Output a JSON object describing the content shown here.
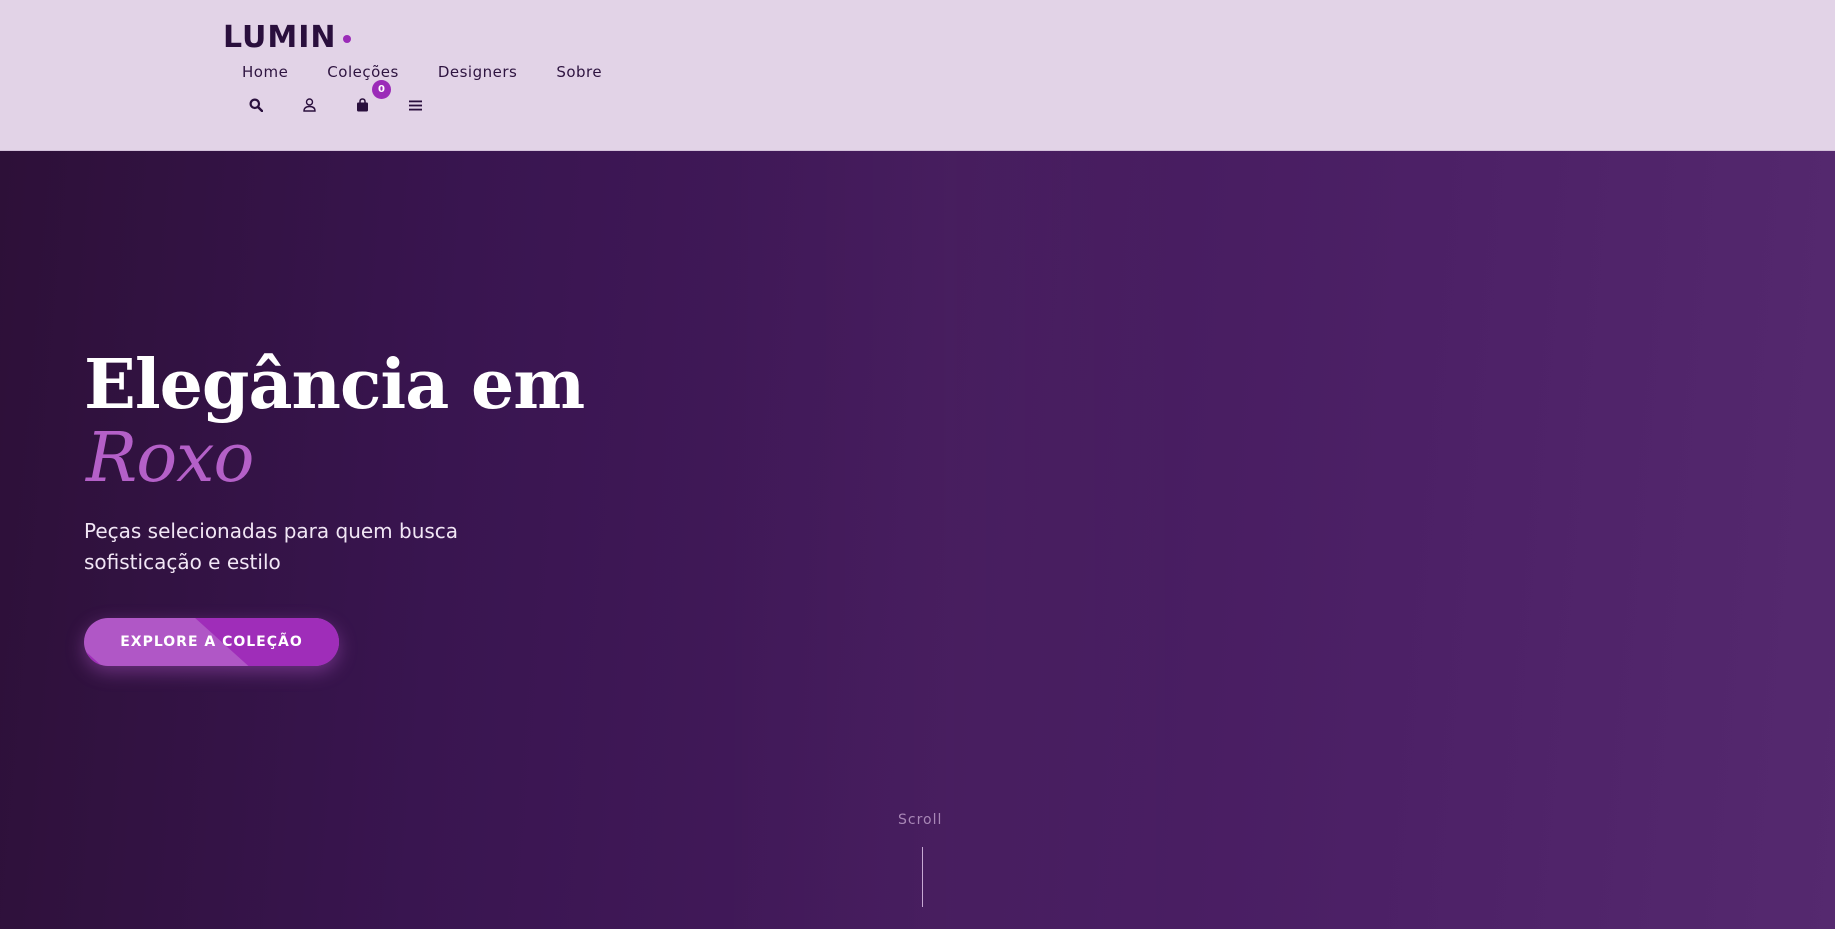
{
  "brand": {
    "name": "LUMIN",
    "accent_color": "#9b2bb8"
  },
  "nav": {
    "links": [
      {
        "label": "Home"
      },
      {
        "label": "Coleções"
      },
      {
        "label": "Designers"
      },
      {
        "label": "Sobre"
      }
    ]
  },
  "header_icons": {
    "search": "search-icon",
    "account": "user-icon",
    "cart": "shopping-bag-icon",
    "menu": "hamburger-menu-icon",
    "cart_count": "0"
  },
  "hero": {
    "title": "Elegância em",
    "title_accent": "Roxo",
    "subtitle": "Peças selecionadas para quem busca sofisticação e estilo",
    "cta_label": "EXPLORE A COLEÇÃO",
    "scroll_label": "Scroll"
  },
  "colors": {
    "header_bg": "#e2d3e7",
    "hero_bg_start": "#2d1038",
    "hero_bg_end": "#55296f",
    "title_accent": "#b460c8",
    "cta": "#b057c6"
  }
}
